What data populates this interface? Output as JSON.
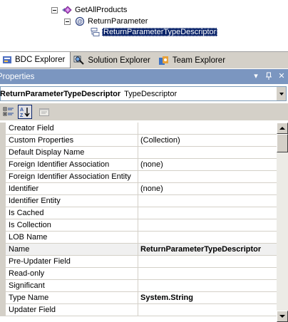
{
  "tree": {
    "items": [
      {
        "label": "GetAllProducts",
        "icon": "method-icon"
      },
      {
        "label": "ReturnParameter",
        "icon": "parameter-icon"
      },
      {
        "label": "ReturnParameterTypeDescriptor",
        "icon": "type-descriptor-icon",
        "selected": true
      }
    ]
  },
  "tabs": [
    {
      "label": "BDC Explorer",
      "icon": "bdc-explorer-icon",
      "active": true
    },
    {
      "label": "Solution Explorer",
      "icon": "solution-explorer-icon",
      "active": false
    },
    {
      "label": "Team Explorer",
      "icon": "team-explorer-icon",
      "active": false
    }
  ],
  "properties_panel": {
    "title": "Properties",
    "pin_glyph": "▾",
    "autohide_glyph": "ᛘ",
    "close_glyph": "✕",
    "object_name": "ReturnParameterTypeDescriptor",
    "object_type": "TypeDescriptor",
    "toolbar": [
      {
        "name": "categorized-icon",
        "pressed": false
      },
      {
        "name": "alphabetical-icon",
        "pressed": true
      },
      {
        "name": "property-pages-icon",
        "pressed": false
      }
    ],
    "rows": [
      {
        "name": "Creator Field",
        "value": ""
      },
      {
        "name": "Custom Properties",
        "value": "(Collection)"
      },
      {
        "name": "Default Display Name",
        "value": ""
      },
      {
        "name": "Foreign Identifier Association",
        "value": "(none)"
      },
      {
        "name": "Foreign Identifier Association Entity",
        "value": ""
      },
      {
        "name": "Identifier",
        "value": "(none)"
      },
      {
        "name": "Identifier Entity",
        "value": ""
      },
      {
        "name": "Is Cached",
        "value": ""
      },
      {
        "name": "Is Collection",
        "value": ""
      },
      {
        "name": "LOB Name",
        "value": ""
      },
      {
        "name": "Name",
        "value": "ReturnParameterTypeDescriptor",
        "bold": true,
        "selected": true
      },
      {
        "name": "Pre-Updater Field",
        "value": ""
      },
      {
        "name": "Read-only",
        "value": ""
      },
      {
        "name": "Significant",
        "value": ""
      },
      {
        "name": "Type Name",
        "value": "System.String",
        "bold": true
      },
      {
        "name": "Updater Field",
        "value": ""
      }
    ]
  },
  "colors": {
    "titlebar": "#7b96c0",
    "selection": "#0a246a",
    "chrome": "#d4d0c8"
  }
}
